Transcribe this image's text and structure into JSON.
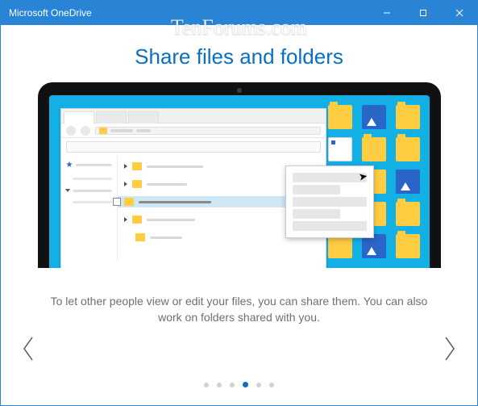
{
  "window": {
    "title": "Microsoft OneDrive"
  },
  "watermark": "TenForums.com",
  "slide": {
    "heading": "Share files and folders",
    "description": "To let other people view or edit your files, you can share them. You can also work on folders shared with you."
  },
  "pager": {
    "total": 6,
    "active_index": 3
  }
}
